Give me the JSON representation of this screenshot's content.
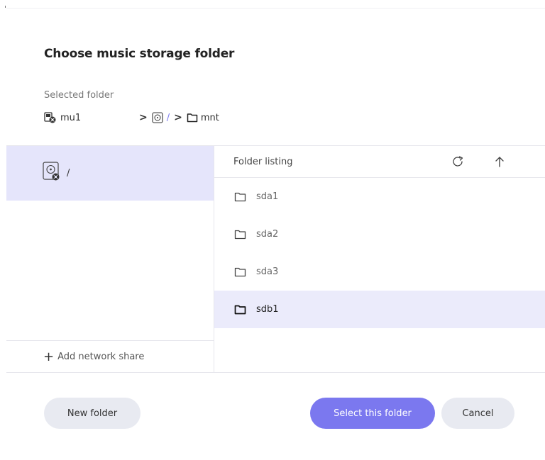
{
  "dialog": {
    "title": "Choose music storage folder",
    "selected_label": "Selected folder"
  },
  "breadcrumb": {
    "host": "mu1",
    "separator": ">",
    "root": "/",
    "current": "mnt"
  },
  "sources": {
    "items": [
      {
        "label": "/",
        "icon": "drive-icon",
        "selected": true
      }
    ],
    "add_share_label": "Add network share"
  },
  "listing": {
    "header": "Folder listing",
    "folders": [
      {
        "name": "sda1",
        "selected": false
      },
      {
        "name": "sda2",
        "selected": false
      },
      {
        "name": "sda3",
        "selected": false
      },
      {
        "name": "sdb1",
        "selected": true
      }
    ]
  },
  "buttons": {
    "new_folder": "New folder",
    "select_folder": "Select this folder",
    "cancel": "Cancel"
  },
  "colors": {
    "accent": "#7b78ef",
    "selection": "#e5e5fb",
    "button_neutral": "#e8eaf1"
  }
}
